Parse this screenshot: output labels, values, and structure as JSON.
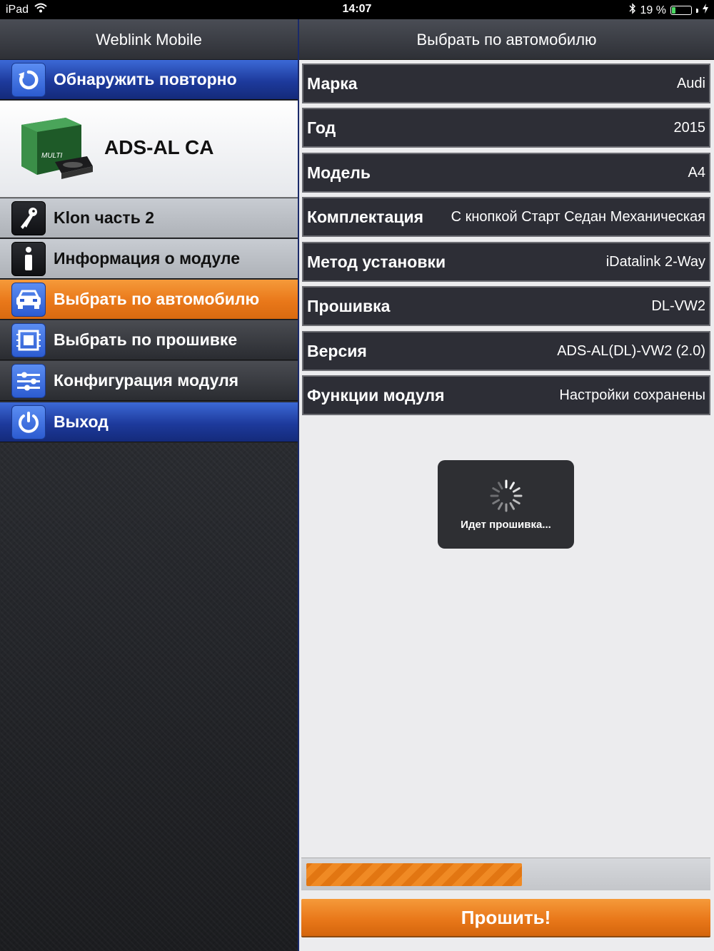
{
  "status_bar": {
    "device": "iPad",
    "time": "14:07",
    "battery_text": "19 %",
    "battery_level": 0.19
  },
  "left": {
    "title": "Weblink Mobile",
    "rediscover": "Обнаружить повторно",
    "device_name": "ADS-AL CA",
    "device_image_text": "MULTI",
    "menu": [
      {
        "label": "Klon часть 2",
        "icon": "key-icon"
      },
      {
        "label": "Информация о модуле",
        "icon": "info-icon"
      },
      {
        "label": "Выбрать по автомобилю",
        "icon": "car-icon",
        "active": true
      },
      {
        "label": "Выбрать по прошивке",
        "icon": "chip-icon"
      },
      {
        "label": "Конфигурация модуля",
        "icon": "sliders-icon"
      }
    ],
    "exit": "Выход"
  },
  "right": {
    "title": "Выбрать по автомобилю",
    "rows": [
      {
        "label": "Марка",
        "value": "Audi"
      },
      {
        "label": "Год",
        "value": "2015"
      },
      {
        "label": "Модель",
        "value": "A4"
      },
      {
        "label": "Комплектация",
        "value": "С кнопкой Старт Седан Механическая"
      },
      {
        "label": "Метод установки",
        "value": "iDatalink 2-Way"
      },
      {
        "label": "Прошивка",
        "value": "DL-VW2"
      },
      {
        "label": "Версия",
        "value": "ADS-AL(DL)-VW2 (2.0)"
      },
      {
        "label": "Функции модуля",
        "value": "Настройки сохранены"
      }
    ],
    "toast": "Идет прошивка...",
    "progress": 0.54,
    "flash_button": "Прошить!"
  },
  "colors": {
    "accent_orange": "#e9781a",
    "accent_blue": "#1d3a9c",
    "row_bg": "#2d2e36"
  }
}
